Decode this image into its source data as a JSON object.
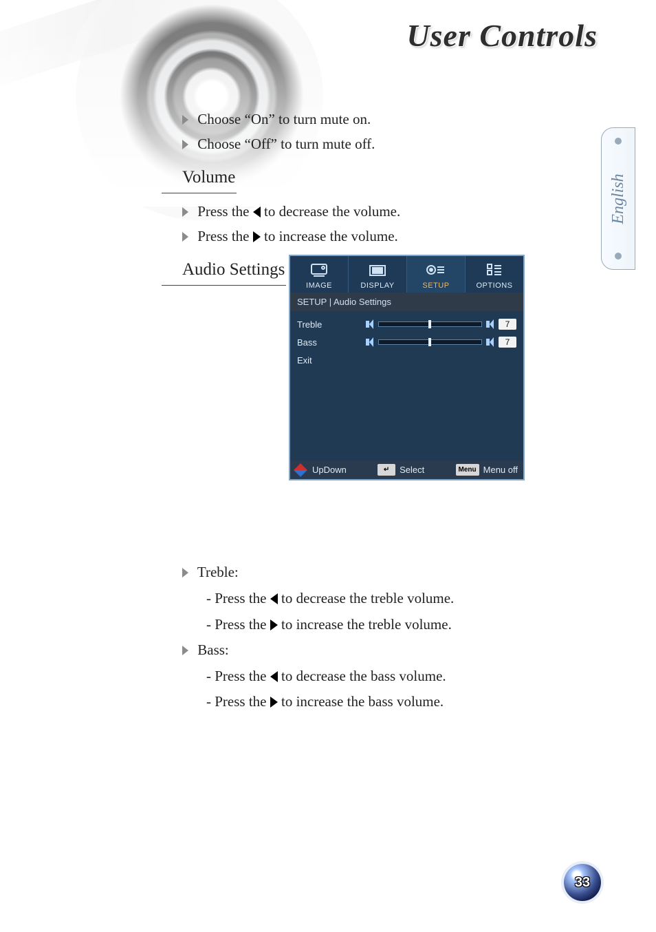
{
  "chapter_title": "User Controls",
  "language_tab": "English",
  "page_number": "33",
  "mute": {
    "on": "Choose “On” to turn mute on.",
    "off": "Choose “Off” to turn mute off."
  },
  "sections": {
    "volume": {
      "heading": "Volume",
      "dec_pre": "Press the ",
      "dec_post": " to decrease the volume.",
      "inc_pre": "Press the ",
      "inc_post": " to increase the volume."
    },
    "audio": {
      "heading": "Audio Settings"
    }
  },
  "osd": {
    "tabs": [
      "IMAGE",
      "DISPLAY",
      "SETUP",
      "OPTIONS"
    ],
    "active_tab_index": 2,
    "breadcrumb": "SETUP | Audio Settings",
    "rows": [
      {
        "label": "Treble",
        "value": 7,
        "slider_pct": 48
      },
      {
        "label": "Bass",
        "value": 7,
        "slider_pct": 48
      },
      {
        "label": "Exit"
      }
    ],
    "footer": {
      "updown": "UpDown",
      "select_key": "↵",
      "select": "Select",
      "menu_key": "Menu",
      "menu_off": "Menu off"
    }
  },
  "treble_block": {
    "heading": "Treble:",
    "dec_pre": "- Press the ",
    "dec_post": " to decrease the treble volume.",
    "inc_pre": "- Press the ",
    "inc_post": " to increase the treble volume."
  },
  "bass_block": {
    "heading": "Bass:",
    "dec_pre": "- Press the ",
    "dec_post": " to decrease the bass volume.",
    "inc_pre": "- Press the ",
    "inc_post": " to increase the bass volume."
  }
}
